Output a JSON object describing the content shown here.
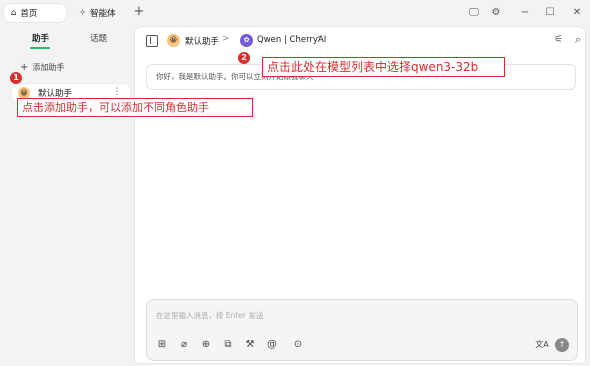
{
  "top_tabs": [
    {
      "label": "首页",
      "icon": "home-icon"
    },
    {
      "label": "智能体",
      "icon": "sparkle-icon"
    }
  ],
  "window": {
    "add_tab": "+",
    "monitor": "🖵",
    "settings": "⚙",
    "minimize": "−",
    "maximize": "☐",
    "close": "✕"
  },
  "sidebar": {
    "tab_assistants": "助手",
    "tab_topics": "话题",
    "add_assistant": "添加助手",
    "assistant_item": {
      "emoji": "😀",
      "label": "默认助手",
      "more": "⋮"
    }
  },
  "header": {
    "assistant_emoji": "😀",
    "assistant_name": "默认助手",
    "separator": ">",
    "model_name": "Qwen | CherryAI",
    "model_caret": "⌃"
  },
  "welcome_text": "你好，我是默认助手。你可以立刻开始跟我聊天",
  "composer": {
    "placeholder": "在这里输入消息，按 Enter 发送",
    "send": "↑",
    "translate": "文A"
  },
  "annotations": {
    "step1_num": "1",
    "step1_text": "点击添加助手，可以添加不同角色助手",
    "step2_num": "2",
    "step2_text": "点击此处在模型列表中选择qwen3-32b"
  },
  "colors": {
    "accent": "#2bb673",
    "annotation_red": "#d03030",
    "model_icon": "#6f5bd6"
  }
}
